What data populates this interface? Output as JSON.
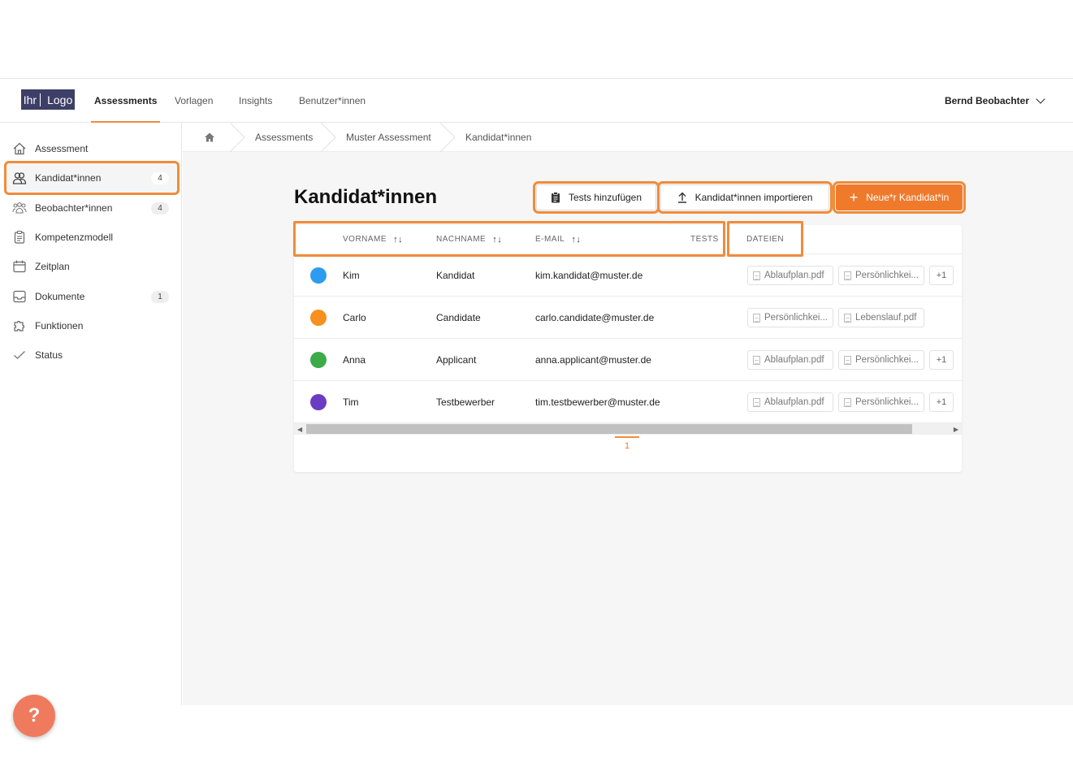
{
  "header": {
    "logo": {
      "part1": "Ihr",
      "part2": "Logo"
    },
    "nav": [
      "Assessments",
      "Vorlagen",
      "Insights",
      "Benutzer*innen"
    ],
    "user": "Bernd Beobachter"
  },
  "sidebar": {
    "items": [
      {
        "label": "Assessment",
        "badge": "",
        "icon": "home-icon"
      },
      {
        "label": "Kandidat*innen",
        "badge": "4",
        "icon": "users-icon"
      },
      {
        "label": "Beobachter*innen",
        "badge": "4",
        "icon": "group-icon"
      },
      {
        "label": "Kompetenzmodell",
        "badge": "",
        "icon": "clipboard-icon"
      },
      {
        "label": "Zeitplan",
        "badge": "",
        "icon": "calendar-icon"
      },
      {
        "label": "Dokumente",
        "badge": "1",
        "icon": "inbox-icon"
      },
      {
        "label": "Funktionen",
        "badge": "",
        "icon": "puzzle-icon"
      },
      {
        "label": "Status",
        "badge": "",
        "icon": "check-icon"
      }
    ],
    "help": "?"
  },
  "breadcrumb": [
    "Assessments",
    "Muster Assessment",
    "Kandidat*innen"
  ],
  "page": {
    "title": "Kandidat*innen",
    "buttons": {
      "add_tests": "Tests hinzufügen",
      "import": "Kandidat*innen importieren",
      "new": "Neue*r Kandidat*in"
    }
  },
  "table": {
    "headers": {
      "vorname": "VORNAME",
      "nachname": "NACHNAME",
      "email": "E-MAIL",
      "tests": "TESTS",
      "dateien": "DATEIEN"
    },
    "rows": [
      {
        "color": "#2d9cf0",
        "vorname": "Kim",
        "nachname": "Kandidat",
        "email": "kim.kandidat@muster.de",
        "files": [
          "Ablaufplan.pdf",
          "Persönlichkei..."
        ],
        "more": "+1"
      },
      {
        "color": "#f7901e",
        "vorname": "Carlo",
        "nachname": "Candidate",
        "email": "carlo.candidate@muster.de",
        "files": [
          "Persönlichkei...",
          "Lebenslauf.pdf"
        ],
        "more": ""
      },
      {
        "color": "#3cab4a",
        "vorname": "Anna",
        "nachname": "Applicant",
        "email": "anna.applicant@muster.de",
        "files": [
          "Ablaufplan.pdf",
          "Persönlichkei..."
        ],
        "more": "+1"
      },
      {
        "color": "#6a3cc2",
        "vorname": "Tim",
        "nachname": "Testbewerber",
        "email": "tim.testbewerber@muster.de",
        "files": [
          "Ablaufplan.pdf",
          "Persönlichkei..."
        ],
        "more": "+1"
      }
    ],
    "page": "1"
  },
  "colors": {
    "accent": "#f08c3a",
    "primary_button": "#f07a2c"
  }
}
